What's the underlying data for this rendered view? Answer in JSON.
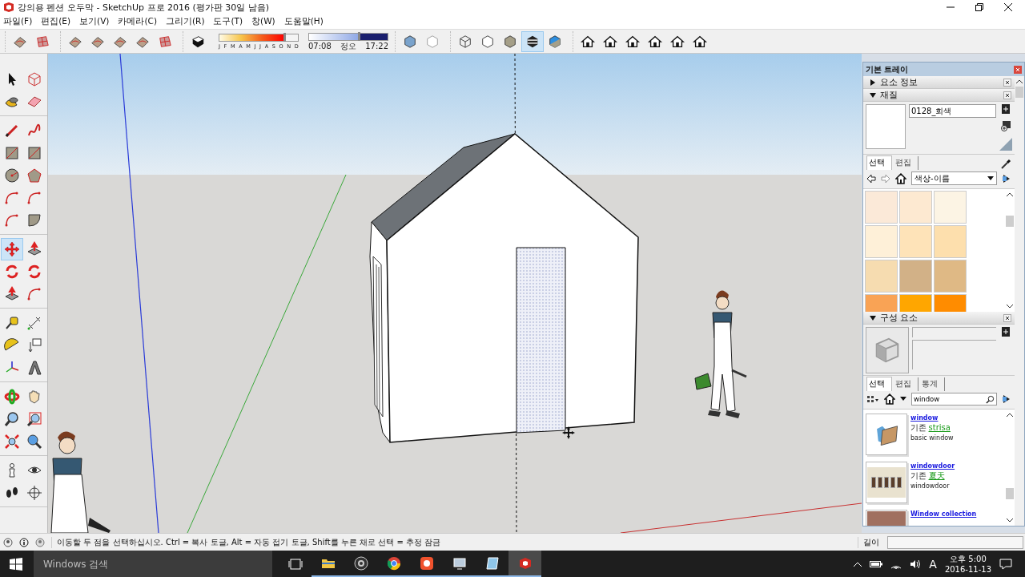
{
  "window": {
    "title": "강의용 펜션 오두막 - SketchUp 프로 2016 (평가판 30일 남음)"
  },
  "menu": [
    "파일(F)",
    "편집(E)",
    "보기(V)",
    "카메라(C)",
    "그리기(R)",
    "도구(T)",
    "창(W)",
    "도움말(H)"
  ],
  "toolbar": {
    "groups_left": [
      [
        {
          "selected": false
        },
        {
          "selected": false
        }
      ],
      [
        {
          "selected": false
        },
        {
          "selected": false
        },
        {
          "selected": false
        },
        {
          "selected": false
        },
        {
          "selected": false
        }
      ],
      [
        {
          "selected": false
        }
      ]
    ],
    "date_slider": {
      "level": 0.83,
      "labels": [
        "J",
        "F",
        "M",
        "A",
        "M",
        "J",
        "J",
        "A",
        "S",
        "O",
        "N",
        "D"
      ]
    },
    "time_slider": {
      "level": 0.63,
      "labels": [
        "07:08",
        "정오",
        "17:22"
      ]
    },
    "groups_right": [
      [
        {
          "selected": false
        },
        {
          "selected": false
        }
      ],
      [
        {
          "selected": false
        },
        {
          "selected": false
        },
        {
          "selected": false
        },
        {
          "selected": true
        },
        {
          "selected": false
        }
      ],
      [
        {
          "selected": false
        },
        {
          "selected": false
        },
        {
          "selected": false
        },
        {
          "selected": false
        },
        {
          "selected": false
        },
        {
          "selected": false
        }
      ]
    ]
  },
  "left_toolbar": [
    [
      {
        "selected": false
      },
      {
        "selected": false
      },
      {
        "selected": false
      },
      {
        "selected": false
      }
    ],
    [
      {
        "selected": false
      },
      {
        "selected": false
      },
      {
        "selected": false
      },
      {
        "selected": false
      },
      {
        "selected": false
      },
      {
        "selected": false
      },
      {
        "selected": false
      },
      {
        "selected": false
      },
      {
        "selected": false
      },
      {
        "selected": false
      }
    ],
    [
      {
        "selected": true
      },
      {
        "selected": false
      },
      {
        "selected": false
      },
      {
        "selected": false
      },
      {
        "selected": false
      },
      {
        "selected": false
      }
    ],
    [
      {
        "selected": false
      },
      {
        "selected": false
      },
      {
        "selected": false
      },
      {
        "selected": false
      },
      {
        "selected": false
      },
      {
        "selected": false
      }
    ],
    [
      {
        "selected": false
      },
      {
        "selected": false
      },
      {
        "selected": false
      },
      {
        "selected": false
      },
      {
        "selected": false
      },
      {
        "selected": false
      }
    ],
    [
      {
        "selected": false
      },
      {
        "selected": false
      },
      {
        "selected": false
      },
      {
        "selected": false
      }
    ]
  ],
  "tray": {
    "title": "기본 트레이",
    "panels": [
      {
        "title": "요소 정보",
        "expanded": false
      },
      {
        "kind": "materials",
        "title": "재질",
        "expanded": true,
        "name_value": "0128_회색",
        "tabs": [
          {
            "label": "선택",
            "selected": true
          },
          {
            "label": "편집",
            "selected": false
          }
        ],
        "library": "색상-이름",
        "swatches": [
          {
            "color": "#fbe9d8"
          },
          {
            "color": "#fde9d1"
          },
          {
            "color": "#fcf4e4"
          },
          {
            "color": "#fef0d8"
          },
          {
            "color": "#fee3b8"
          },
          {
            "color": "#fddfad"
          },
          {
            "color": "#f6dcb0"
          },
          {
            "color": "#d2b187"
          },
          {
            "color": "#dfb985"
          },
          {
            "color": "#f9a355"
          },
          {
            "color": "#ffa600"
          },
          {
            "color": "#ff8c00"
          }
        ]
      },
      {
        "kind": "components",
        "title": "구성 요소",
        "expanded": true,
        "tabs": [
          {
            "label": "선택",
            "selected": true
          },
          {
            "label": "편집",
            "selected": false
          },
          {
            "label": "통계",
            "selected": false
          }
        ],
        "search_value": "window",
        "results": [
          {
            "kind": "folder",
            "title": "window",
            "prefix": "기존",
            "author": "strisa",
            "description": "basic window"
          },
          {
            "kind": "windows",
            "title": "windowdoor",
            "prefix": "기존",
            "author": "夏天",
            "description": "windowdoor"
          },
          {
            "kind": "collection",
            "title": "Window collection"
          }
        ]
      }
    ]
  },
  "status_bar": {
    "message": "이동할 두 점을 선택하십시오. Ctrl = 복사 토글, Alt = 자동 접기 토글, Shift를 누른 채로 선택 = 추정 잠금",
    "measure_label": "길이"
  },
  "taskbar": {
    "search_placeholder": "Windows 검색",
    "apps": [
      {
        "running": false,
        "selected": false
      },
      {
        "running": true,
        "selected": false
      },
      {
        "running": true,
        "selected": false
      },
      {
        "running": true,
        "selected": false
      },
      {
        "running": true,
        "selected": false
      },
      {
        "running": true,
        "selected": false
      },
      {
        "running": true,
        "selected": false
      },
      {
        "running": true,
        "selected": true
      }
    ],
    "ime": "A",
    "time": "오후 5:00",
    "date": "2016-11-13"
  }
}
